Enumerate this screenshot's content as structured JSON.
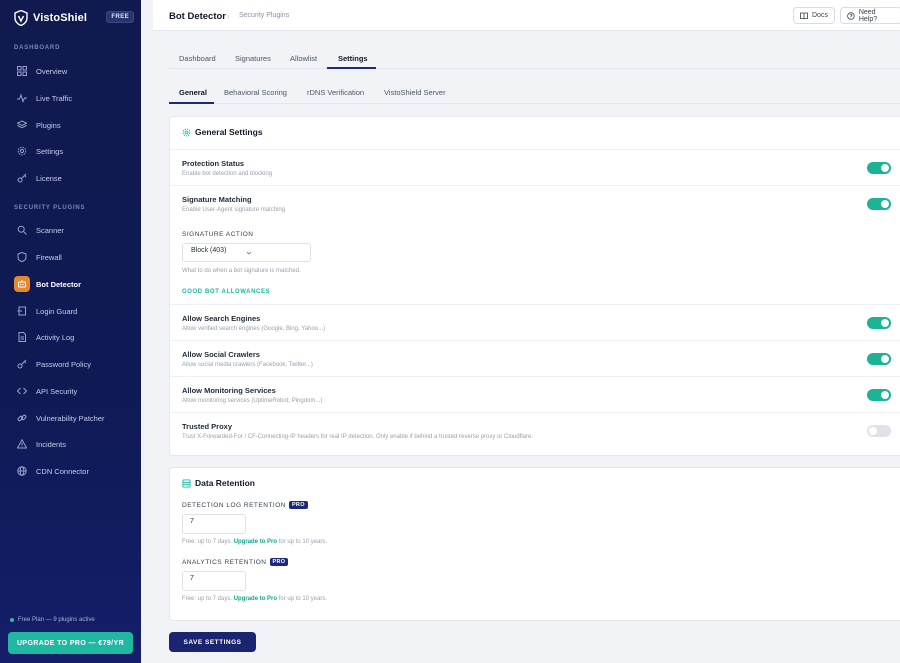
{
  "brand": {
    "name": "VistoShiel",
    "badge": "FREE"
  },
  "sidebar": {
    "section_dashboard": "DASHBOARD",
    "dashboard_items": [
      {
        "label": "Overview",
        "icon": "grid-icon"
      },
      {
        "label": "Live Traffic",
        "icon": "pulse-icon"
      },
      {
        "label": "Plugins",
        "icon": "layers-icon"
      },
      {
        "label": "Settings",
        "icon": "gear-icon"
      },
      {
        "label": "License",
        "icon": "key-icon"
      }
    ],
    "section_security": "SECURITY PLUGINS",
    "security_items": [
      {
        "label": "Scanner",
        "icon": "search-icon"
      },
      {
        "label": "Firewall",
        "icon": "shield-icon"
      },
      {
        "label": "Bot Detector",
        "icon": "bot-icon",
        "active": true
      },
      {
        "label": "Login Guard",
        "icon": "login-icon"
      },
      {
        "label": "Activity Log",
        "icon": "file-icon"
      },
      {
        "label": "Password Policy",
        "icon": "key-icon"
      },
      {
        "label": "API Security",
        "icon": "code-icon"
      },
      {
        "label": "Vulnerability Patcher",
        "icon": "link-icon"
      },
      {
        "label": "Incidents",
        "icon": "alert-icon"
      },
      {
        "label": "CDN Connector",
        "icon": "globe-icon"
      }
    ],
    "plan_text": "Free Plan — 9 plugins active",
    "upgrade_label": "UPGRADE TO PRO — €79/YR"
  },
  "header": {
    "title": "Bot Detector",
    "separator": "›",
    "breadcrumb": "Security Plugins",
    "docs_label": "Docs",
    "help_label": "Need Help?"
  },
  "tabs": [
    "Dashboard",
    "Signatures",
    "Allowlist",
    "Settings"
  ],
  "active_tab": "Settings",
  "subtabs": [
    "General",
    "Behavioral Scoring",
    "rDNS Verification",
    "VistoShield Server"
  ],
  "active_subtab": "General",
  "general": {
    "title": "General Settings",
    "protection": {
      "label": "Protection Status",
      "desc": "Enable bot detection and blocking",
      "enabled": true
    },
    "signature": {
      "label": "Signature Matching",
      "desc": "Enable User-Agent signature matching",
      "enabled": true
    },
    "action_label": "SIGNATURE ACTION",
    "action_value": "Block (403)",
    "action_hint": "What to do when a bot signature is matched.",
    "good_bot_heading": "GOOD BOT ALLOWANCES",
    "search_engines": {
      "label": "Allow Search Engines",
      "desc": "Allow verified search engines (Google, Bing, Yahoo...)",
      "enabled": true
    },
    "social": {
      "label": "Allow Social Crawlers",
      "desc": "Allow social media crawlers (Facebook, Twitter...)",
      "enabled": true
    },
    "monitoring": {
      "label": "Allow Monitoring Services",
      "desc": "Allow monitoring services (UptimeRobot, Pingdom...)",
      "enabled": true
    },
    "proxy": {
      "label": "Trusted Proxy",
      "desc": "Trust X-Forwarded-For / CF-Connecting-IP headers for real IP detection. Only enable if behind a trusted reverse proxy or Cloudflare.",
      "enabled": false
    }
  },
  "retention": {
    "title": "Data Retention",
    "pro_badge": "PRO",
    "detection_label": "DETECTION LOG RETENTION",
    "detection_value": "7",
    "detection_hint_prefix": "Free: up to 7 days.",
    "upgrade_link": "Upgrade to Pro",
    "hint_suffix": "for up to 10 years.",
    "analytics_label": "ANALYTICS RETENTION",
    "analytics_value": "7",
    "analytics_hint_prefix": "Free: up to 7 days."
  },
  "save_label": "SAVE SETTINGS"
}
